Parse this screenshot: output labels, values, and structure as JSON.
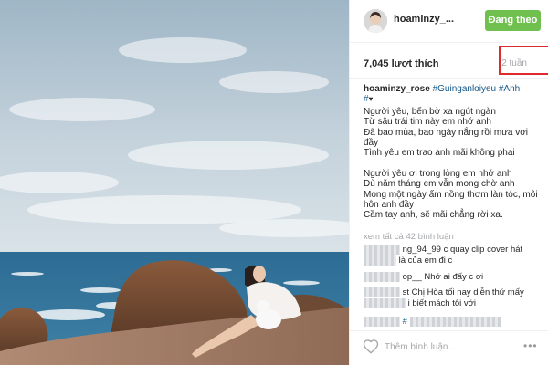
{
  "post": {
    "image_alt": "woman-sitting-on-seaside-rocks-photo",
    "author": {
      "username": "hoaminzy_...",
      "follow_button_label": "Đang theo dõi"
    },
    "likes_text": "7,045 lượt thích",
    "time_text": "2 tuần",
    "caption": {
      "username": "hoaminzy_rose",
      "hashtags": [
        "#Guinganloiyeu",
        "#Anh",
        "#"
      ],
      "heart": "♥",
      "stanzas": [
        [
          "Người yêu, bến bờ xa ngút ngàn",
          "Từ sâu trái tim này em nhớ anh",
          "Đã bao mùa, bao ngày nắng rồi mưa vơi đầy",
          "Tình yêu em trao anh mãi không phai"
        ],
        [
          "Người yêu ơi trong lòng em nhớ anh",
          "Dù năm tháng em vẫn mong chờ anh",
          "Mong một ngày ấm nồng thơm làn tóc, môi hôn anh đầy",
          "Cầm tay anh, sẽ mãi chẳng rời xa."
        ]
      ]
    },
    "view_all_comments_label": "xem tất cả 42 bình luận",
    "comments": [
      {
        "username_partial": "ng_94_99",
        "text": "c quay clip cover hát",
        "text_line2": "là của em đi c"
      },
      {
        "username_partial": "op__",
        "text": "Nhớ ai đấy c ơi"
      },
      {
        "username_partial": "st",
        "text": "Chị Hòa tối nay diễn thứ mấy",
        "text_line2": "i biết mách tôi với"
      },
      {
        "username_partial": "",
        "text": "#"
      }
    ],
    "comment_input_placeholder": "Thêm bình luận...",
    "more_label": "•••"
  },
  "colors": {
    "follow_button": "#70c050",
    "hashtag": "#125688",
    "muted_text": "#a5a7aa",
    "highlight_box": "#e0292e"
  },
  "icons": [
    "avatar-image",
    "heart-outline-icon",
    "more-options-icon"
  ]
}
